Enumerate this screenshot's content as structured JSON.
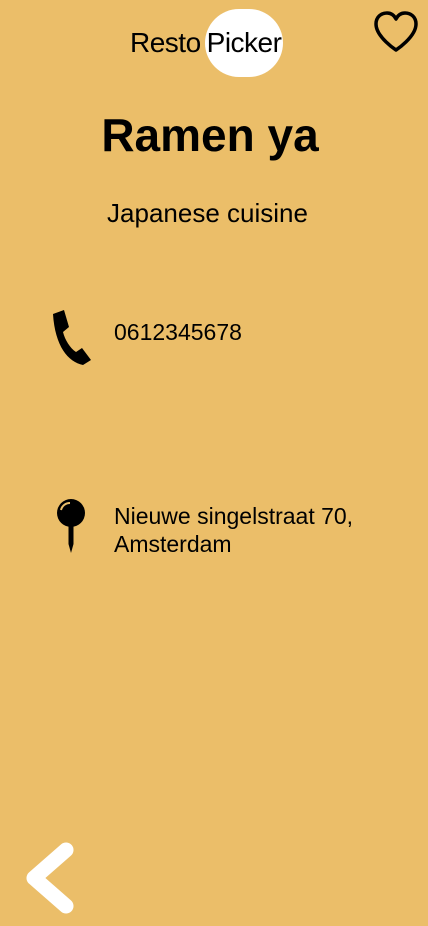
{
  "app": {
    "logo_part1": "Resto",
    "logo_part2": "Picker"
  },
  "restaurant": {
    "name": "Ramen ya",
    "cuisine": "Japanese cuisine",
    "phone": "0612345678",
    "address_line1": "Nieuwe singelstraat 70,",
    "address_line2": "Amsterdam"
  },
  "icons": {
    "favorite": "heart-outline-icon",
    "phone": "phone-icon",
    "location": "map-pin-icon",
    "back": "chevron-left-icon"
  },
  "colors": {
    "background": "#EBBE69",
    "logo_bubble": "#FFFFFF",
    "text": "#000000",
    "back_icon": "#FFFFFF"
  }
}
